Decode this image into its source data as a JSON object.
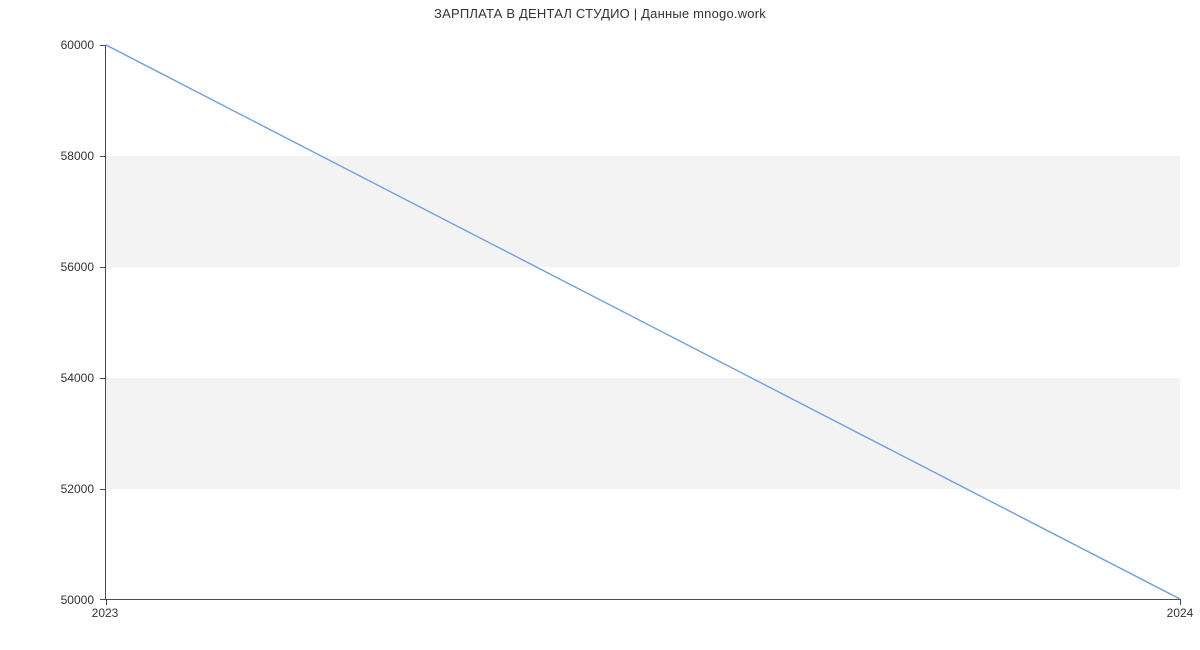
{
  "chart_data": {
    "type": "line",
    "title": "ЗАРПЛАТА В  ДЕНТАЛ СТУДИО | Данные mnogo.work",
    "xlabel": "",
    "ylabel": "",
    "x": [
      "2023",
      "2024"
    ],
    "values": [
      60000,
      50000
    ],
    "ylim": [
      50000,
      60000
    ],
    "yticks": [
      50000,
      52000,
      54000,
      56000,
      58000,
      60000
    ],
    "xticks": [
      "2023",
      "2024"
    ],
    "line_color": "#6f9edb",
    "band_color": "#f3f3f3"
  }
}
